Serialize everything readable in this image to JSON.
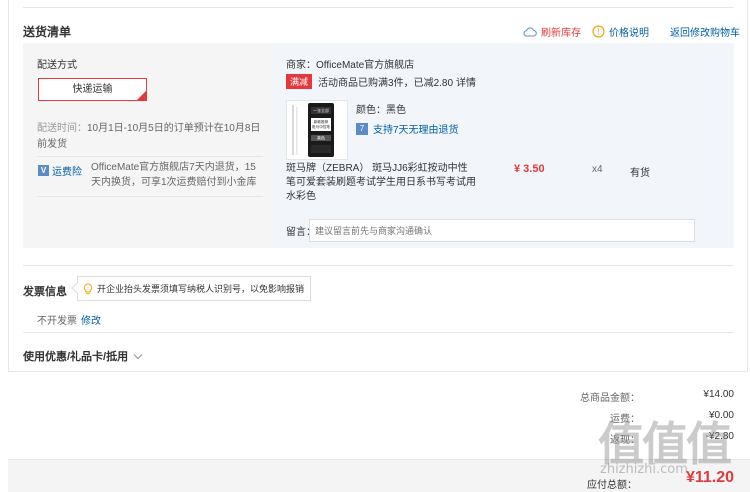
{
  "header": {
    "title": "送货清单",
    "refresh_stock": "刷新库存",
    "price_note": "价格说明",
    "back_to_cart": "返回修改购物车"
  },
  "shipping": {
    "label": "配送方式",
    "option": "快递运输",
    "time_label": "配送时间：",
    "time_text": "10月1日-10月5日的订单预计在10月8日前发货",
    "freight_badge": "运费险",
    "freight_text": "OfficeMate官方旗舰店7天内退货，15天内换货，可享1次运费赔付到小金库"
  },
  "shop": {
    "label": "商家：",
    "name": "OfficeMate官方旗舰店",
    "promo_tag": "满减",
    "promo_text": "活动商品已购满3件，已减2.80",
    "promo_detail": "详情"
  },
  "product": {
    "color_label": "颜色：",
    "color": "黑色",
    "service": "支持7天无理由退货",
    "name": "斑马牌（ZEBRA） 斑马JJ6彩虹按动中性笔可爱套装刷题考试学生用日系书写考试用水彩色",
    "price": "¥ 3.50",
    "qty": "x4",
    "stock": "有货",
    "image_lines": [
      "一张全部",
      "新款推荐",
      "斑马中性笔",
      "黑色"
    ]
  },
  "message": {
    "label": "留言：",
    "placeholder": "建议留言前先与商家沟通确认"
  },
  "invoice": {
    "title": "发票信息",
    "tip": "开企业抬头发票须填写纳税人识别号，以免影响报销",
    "value": "不开发票",
    "edit": "修改"
  },
  "coupon": {
    "title": "使用优惠/礼品卡/抵用"
  },
  "totals": {
    "goods_label": "总商品金额：",
    "goods_value": "¥14.00",
    "freight_label": "运费：",
    "freight_value": "¥0.00",
    "discount_label": "返现：",
    "discount_value": "-¥2.80",
    "pay_label": "应付总额：",
    "pay_value": "¥11.20"
  },
  "watermark": {
    "logo": "值值值",
    "text": "zhizhizhi.com"
  },
  "colors": {
    "accent_red": "#e4393c",
    "link_blue": "#005ea7",
    "panel_gray": "#f5f5f5",
    "panel_blue": "#f2f6fb"
  }
}
